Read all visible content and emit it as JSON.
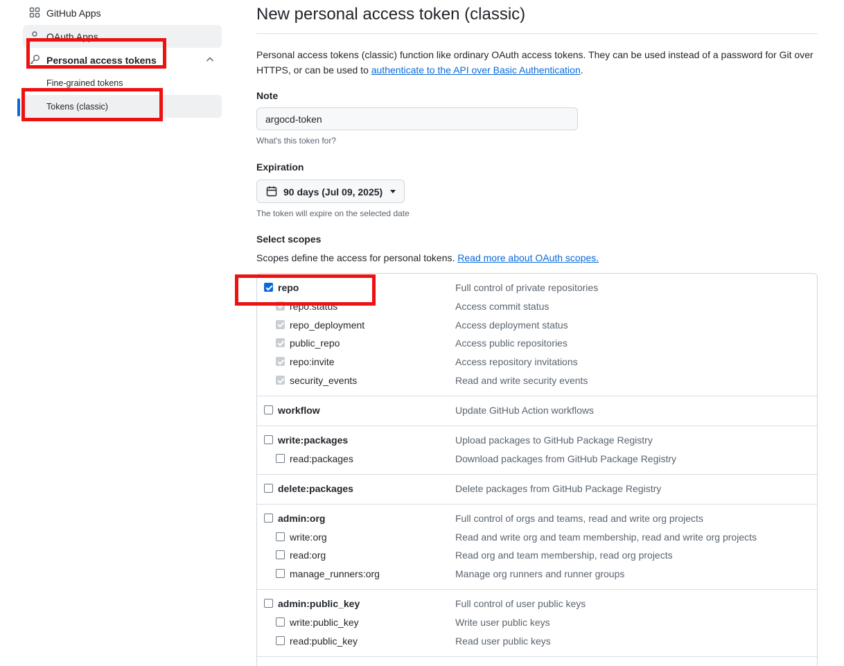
{
  "sidebar": {
    "github_apps": "GitHub Apps",
    "oauth_apps": "OAuth Apps",
    "personal_access_tokens": "Personal access tokens",
    "fine_grained_tokens": "Fine-grained tokens",
    "tokens_classic": "Tokens (classic)"
  },
  "main": {
    "title": "New personal access token (classic)",
    "intro_text": "Personal access tokens (classic) function like ordinary OAuth access tokens. They can be used instead of a password for Git over HTTPS, or can be used to ",
    "intro_link": "authenticate to the API over Basic Authentication",
    "intro_end": ".",
    "note_label": "Note",
    "note_value": "argocd-token",
    "note_hint": "What's this token for?",
    "expiration_label": "Expiration",
    "expiration_value": "90 days (Jul 09, 2025)",
    "expiration_hint": "The token will expire on the selected date",
    "scopes_label": "Select scopes",
    "scopes_desc": "Scopes define the access for personal tokens. ",
    "scopes_link": "Read more about OAuth scopes."
  },
  "scopes": [
    {
      "parent": {
        "name": "repo",
        "desc": "Full control of private repositories",
        "checked": true
      },
      "children": [
        {
          "name": "repo:status",
          "desc": "Access commit status",
          "state": "disabled"
        },
        {
          "name": "repo_deployment",
          "desc": "Access deployment status",
          "state": "disabled"
        },
        {
          "name": "public_repo",
          "desc": "Access public repositories",
          "state": "disabled"
        },
        {
          "name": "repo:invite",
          "desc": "Access repository invitations",
          "state": "disabled"
        },
        {
          "name": "security_events",
          "desc": "Read and write security events",
          "state": "disabled"
        }
      ]
    },
    {
      "parent": {
        "name": "workflow",
        "desc": "Update GitHub Action workflows",
        "checked": false
      },
      "children": []
    },
    {
      "parent": {
        "name": "write:packages",
        "desc": "Upload packages to GitHub Package Registry",
        "checked": false
      },
      "children": [
        {
          "name": "read:packages",
          "desc": "Download packages from GitHub Package Registry",
          "state": "unchecked"
        }
      ]
    },
    {
      "parent": {
        "name": "delete:packages",
        "desc": "Delete packages from GitHub Package Registry",
        "checked": false
      },
      "children": []
    },
    {
      "parent": {
        "name": "admin:org",
        "desc": "Full control of orgs and teams, read and write org projects",
        "checked": false
      },
      "children": [
        {
          "name": "write:org",
          "desc": "Read and write org and team membership, read and write org projects",
          "state": "unchecked"
        },
        {
          "name": "read:org",
          "desc": "Read org and team membership, read org projects",
          "state": "unchecked"
        },
        {
          "name": "manage_runners:org",
          "desc": "Manage org runners and runner groups",
          "state": "unchecked"
        }
      ]
    },
    {
      "parent": {
        "name": "admin:public_key",
        "desc": "Full control of user public keys",
        "checked": false
      },
      "children": [
        {
          "name": "write:public_key",
          "desc": "Write user public keys",
          "state": "unchecked"
        },
        {
          "name": "read:public_key",
          "desc": "Read user public keys",
          "state": "unchecked"
        }
      ]
    }
  ],
  "colors": {
    "accent": "#0969da",
    "annotation_red": "#ee1111"
  }
}
